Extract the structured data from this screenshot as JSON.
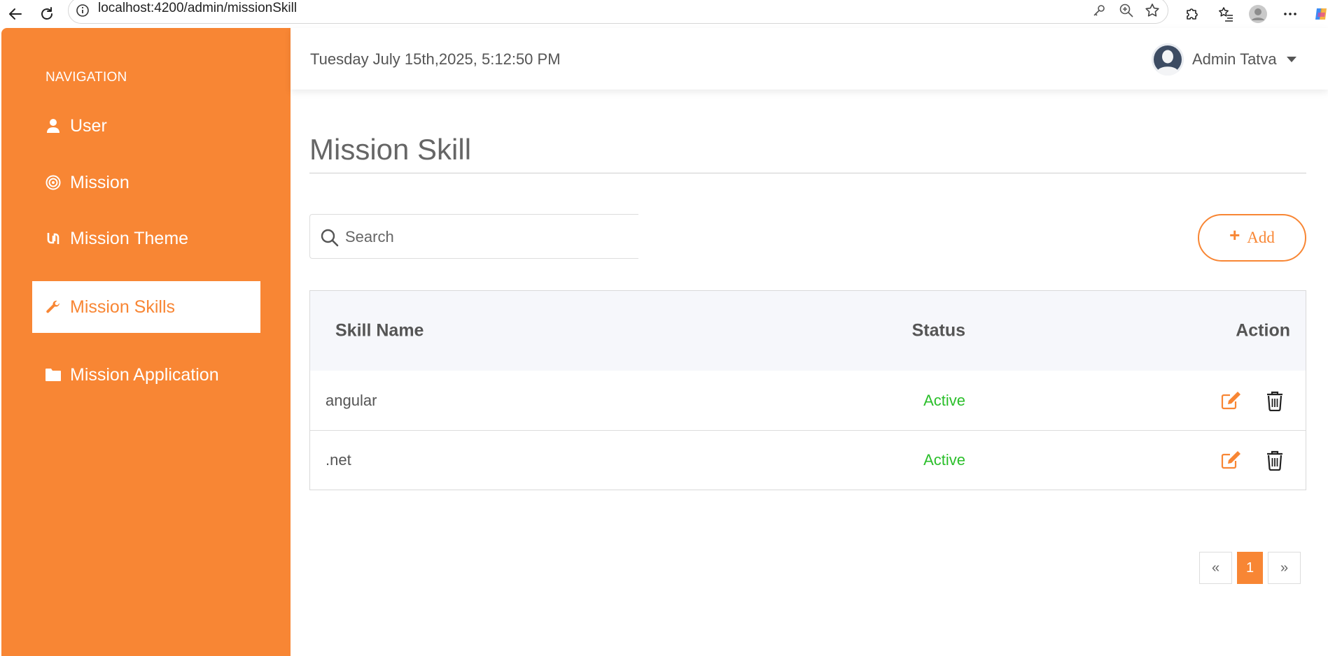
{
  "browser": {
    "url": "localhost:4200/admin/missionSkill"
  },
  "sidebar": {
    "heading": "NAVIGATION",
    "items": [
      {
        "label": "User",
        "icon": "user-icon"
      },
      {
        "label": "Mission",
        "icon": "target-icon"
      },
      {
        "label": "Mission Theme",
        "icon": "theme-icon"
      },
      {
        "label": "Mission Skills",
        "icon": "wrench-icon",
        "active": true
      },
      {
        "label": "Mission Application",
        "icon": "folder-icon"
      }
    ]
  },
  "header": {
    "datetime": "Tuesday July 15th,2025, 5:12:50 PM",
    "user_name": "Admin Tatva"
  },
  "main": {
    "title": "Mission Skill",
    "search_placeholder": "Search",
    "add_label": "Add",
    "table": {
      "columns": [
        "Skill Name",
        "Status",
        "Action"
      ],
      "rows": [
        {
          "skill": "angular",
          "status": "Active"
        },
        {
          "skill": ".net",
          "status": "Active"
        }
      ]
    },
    "pagination": {
      "prev": "«",
      "current": "1",
      "next": "»"
    }
  },
  "colors": {
    "accent": "#f88634",
    "active_status": "#2bbf2b"
  }
}
